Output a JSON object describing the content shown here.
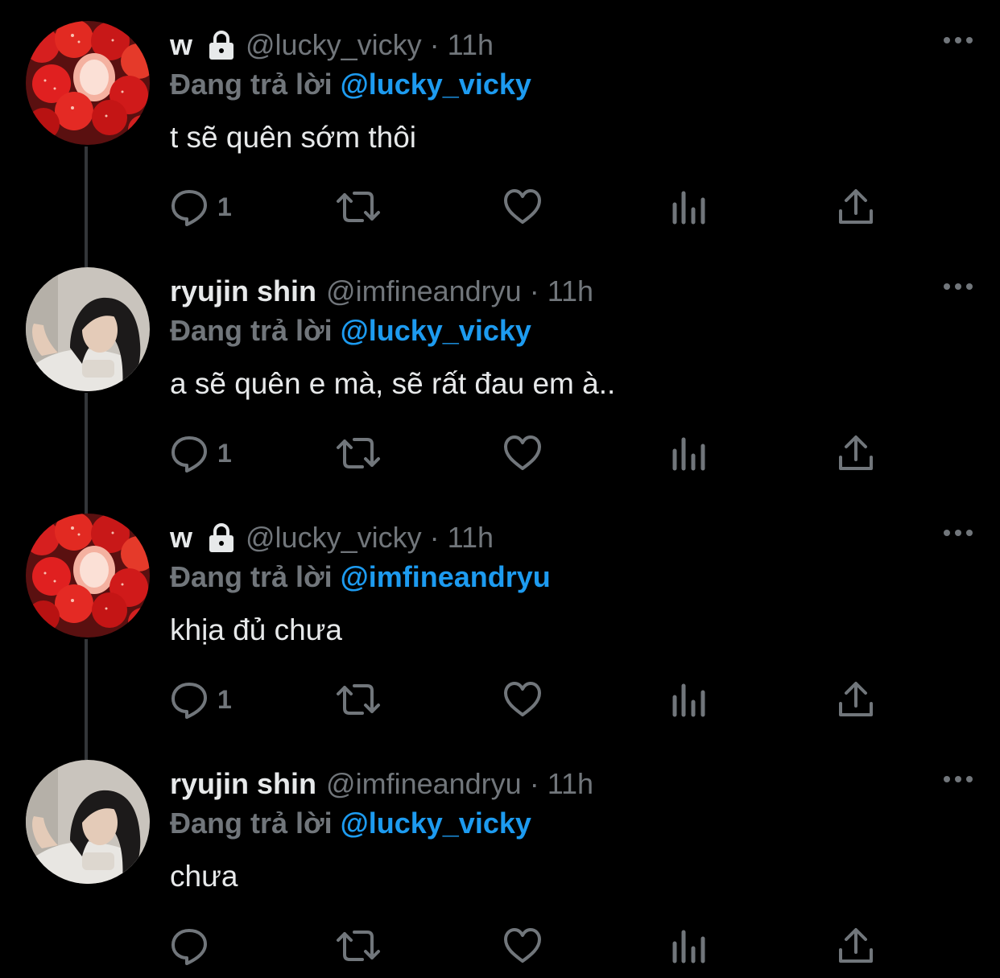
{
  "thread": {
    "tweets": [
      {
        "name": "w",
        "locked": true,
        "handle": "@lucky_vicky",
        "separator": "·",
        "time": "11h",
        "reply_prefix": "Đang trả lời",
        "reply_to": "@lucky_vicky",
        "text": "t sẽ quên sớm thôi",
        "reply_count": "1",
        "avatar_icon": "strawberries-avatar"
      },
      {
        "name": "ryujin shin",
        "locked": false,
        "handle": "@imfineandryu",
        "separator": "·",
        "time": "11h",
        "reply_prefix": "Đang trả lời",
        "reply_to": "@lucky_vicky",
        "text": "a sẽ quên e mà, sẽ rất đau em à..",
        "reply_count": "1",
        "avatar_icon": "girl-portrait-avatar"
      },
      {
        "name": "w",
        "locked": true,
        "handle": "@lucky_vicky",
        "separator": "·",
        "time": "11h",
        "reply_prefix": "Đang trả lời",
        "reply_to": "@imfineandryu",
        "text": "khịa đủ chưa",
        "reply_count": "1",
        "avatar_icon": "strawberries-avatar"
      },
      {
        "name": "ryujin shin",
        "locked": false,
        "handle": "@imfineandryu",
        "separator": "·",
        "time": "11h",
        "reply_prefix": "Đang trả lời",
        "reply_to": "@lucky_vicky",
        "text": "chưa",
        "reply_count": "",
        "avatar_icon": "girl-portrait-avatar"
      }
    ]
  },
  "icons": {
    "more": "more-horizontal-icon",
    "reply": "reply-bubble-icon",
    "retweet": "retweet-icon",
    "like": "heart-icon",
    "views": "views-bar-chart-icon",
    "share": "share-upload-icon",
    "lock": "lock-icon"
  },
  "colors": {
    "background": "#000000",
    "primary_text": "#e7e9ea",
    "secondary_text": "#71767b",
    "accent": "#1d9bf0",
    "thread_line": "#333639"
  }
}
